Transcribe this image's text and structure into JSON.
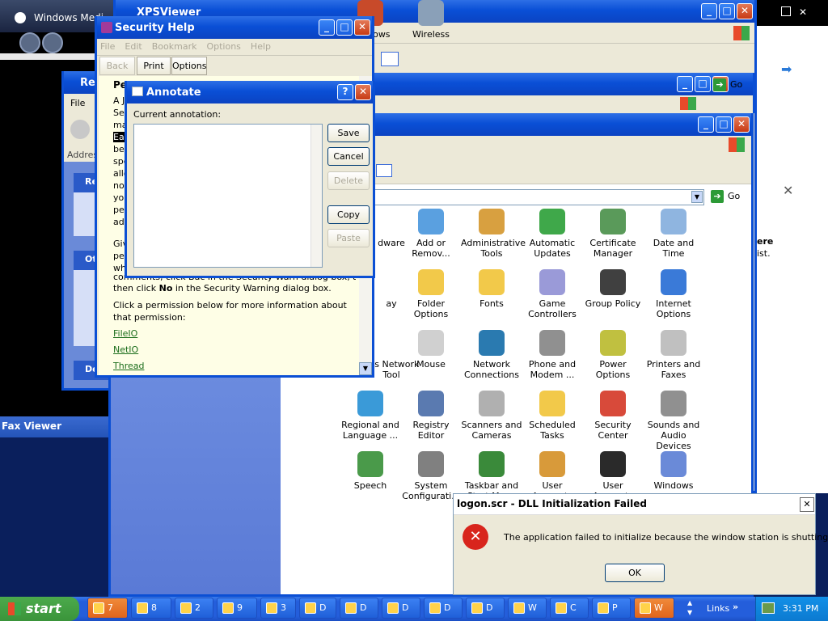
{
  "media_player": {
    "title": "Windows Medi"
  },
  "xps_viewer": {
    "title": "XPSViewer"
  },
  "fax_viewer": {
    "title": "Fax Viewer"
  },
  "recycle": {
    "title": "Rec",
    "menu_file": "File",
    "address": "Addres",
    "panel1": "Re",
    "panel2": "Ot",
    "panel3": "De"
  },
  "explorer2": {
    "go": "Go"
  },
  "control_panel": {
    "go": "Go",
    "side_heading": "ere",
    "side_text": "ist.",
    "items": [
      {
        "label": "dware",
        "icon": "hardware-icon",
        "color": "#7a8fb0"
      },
      {
        "label": "Add or Remov...",
        "icon": "add-remove-programs-icon",
        "color": "#5aa0e0"
      },
      {
        "label": "Administrative Tools",
        "icon": "administrative-tools-icon",
        "color": "#d8a040"
      },
      {
        "label": "Automatic Updates",
        "icon": "windows-update-icon",
        "color": "#3fa84a"
      },
      {
        "label": "Certificate Manager",
        "icon": "certificate-icon",
        "color": "#5a9a5a"
      },
      {
        "label": "Date and Time",
        "icon": "clock-icon",
        "color": "#8fb5e0"
      },
      {
        "label": "ay",
        "icon": "display-icon",
        "color": "#3a8a3a"
      },
      {
        "label": "Folder Options",
        "icon": "folder-options-icon",
        "color": "#f2c94a"
      },
      {
        "label": "Fonts",
        "icon": "fonts-folder-icon",
        "color": "#f2c94a"
      },
      {
        "label": "Game Controllers",
        "icon": "gamepad-icon",
        "color": "#9a9ad8"
      },
      {
        "label": "Group Policy",
        "icon": "group-policy-icon",
        "color": "#404040"
      },
      {
        "label": "Internet Options",
        "icon": "internet-options-icon",
        "color": "#3a7ad8"
      },
      {
        "label": "ous Network Tool",
        "icon": "network-tool-icon",
        "color": "#3a6ad8"
      },
      {
        "label": "Mouse",
        "icon": "mouse-icon",
        "color": "#d0d0d0"
      },
      {
        "label": "Network Connections",
        "icon": "network-connections-icon",
        "color": "#2a7ab0"
      },
      {
        "label": "Phone and Modem ...",
        "icon": "phone-modem-icon",
        "color": "#909090"
      },
      {
        "label": "Power Options",
        "icon": "power-options-icon",
        "color": "#c0c040"
      },
      {
        "label": "Printers and Faxes",
        "icon": "printer-icon",
        "color": "#c0c0c0"
      },
      {
        "label": "Regional and Language ...",
        "icon": "globe-icon",
        "color": "#3a9ad8"
      },
      {
        "label": "Registry Editor",
        "icon": "registry-editor-icon",
        "color": "#5a7ab0"
      },
      {
        "label": "Scanners and Cameras",
        "icon": "scanner-icon",
        "color": "#b0b0b0"
      },
      {
        "label": "Scheduled Tasks",
        "icon": "scheduled-tasks-icon",
        "color": "#f2c94a"
      },
      {
        "label": "Security Center",
        "icon": "shield-icon",
        "color": "#d84a3a"
      },
      {
        "label": "Sounds and Audio Devices",
        "icon": "speaker-icon",
        "color": "#909090"
      },
      {
        "label": "Speech",
        "icon": "speech-icon",
        "color": "#4a9a4a"
      },
      {
        "label": "System Configurati...",
        "icon": "system-config-icon",
        "color": "#808080"
      },
      {
        "label": "Taskbar and Start Menu",
        "icon": "taskbar-icon",
        "color": "#3a8a3a"
      },
      {
        "label": "User Accounts",
        "icon": "user-accounts-icon",
        "color": "#d89a3a"
      },
      {
        "label": "User Accounts",
        "icon": "user-accounts-key-icon",
        "color": "#2a2a2a"
      },
      {
        "label": "Windows",
        "icon": "windows-cardspace-icon",
        "color": "#6a8ad8"
      },
      {
        "label": "Windows",
        "icon": "windows-firewall-icon",
        "color": "#c84a2a"
      },
      {
        "label": "Wireless",
        "icon": "wireless-icon",
        "color": "#8aa0b8"
      }
    ]
  },
  "security_help": {
    "title": "Security Help",
    "menu": [
      "File",
      "Edit",
      "Bookmark",
      "Options",
      "Help"
    ],
    "toolbar": {
      "back": "Back",
      "print": "Print",
      "options": "Options"
    },
    "heading": "Per",
    "lines_left": [
      "A J",
      "Sec",
      "may",
      "Eac",
      "be g",
      "spe",
      "allo",
      "noti",
      "you",
      "perr",
      "adm",
      "Giv",
      "perr",
      "whe"
    ],
    "tail_line1": "comments, click Bac in the Security Warn dialog box, and",
    "tail_line2_pre": "then click ",
    "tail_line2_bold": "No",
    "tail_line2_post": " in the Security Warning dialog box.",
    "para": "Click a permission below for more information about that permission:",
    "links": [
      "FileIO",
      "NetIO",
      "Thread"
    ]
  },
  "annotate": {
    "title": "Annotate",
    "label": "Current annotation:",
    "buttons": {
      "save": "Save",
      "cancel": "Cancel",
      "delete": "Delete",
      "copy": "Copy",
      "paste": "Paste"
    }
  },
  "error_dialog": {
    "title": "logon.scr - DLL Initialization Failed",
    "message": "The application failed to initialize because the window station is shutting down.",
    "ok": "OK"
  },
  "taskbar": {
    "start": "start",
    "groups": [
      {
        "label": "7",
        "icon": "folder-icon"
      },
      {
        "label": "8",
        "icon": "ie-icon"
      },
      {
        "label": "2",
        "icon": "help-icon"
      },
      {
        "label": "9",
        "icon": "console-icon"
      },
      {
        "label": "3",
        "icon": "window-icon"
      },
      {
        "label": "D",
        "icon": "app-icon"
      },
      {
        "label": "D",
        "icon": "window-icon"
      },
      {
        "label": "D",
        "icon": "window-icon"
      },
      {
        "label": "D",
        "icon": "cert-icon"
      },
      {
        "label": "D",
        "icon": "x-icon"
      },
      {
        "label": "W",
        "icon": "media-icon"
      },
      {
        "label": "C",
        "icon": "cmd-icon"
      },
      {
        "label": "P",
        "icon": "search-icon"
      },
      {
        "label": "W",
        "icon": "error-icon"
      }
    ],
    "links": "Links",
    "clock": "3:31 PM"
  }
}
